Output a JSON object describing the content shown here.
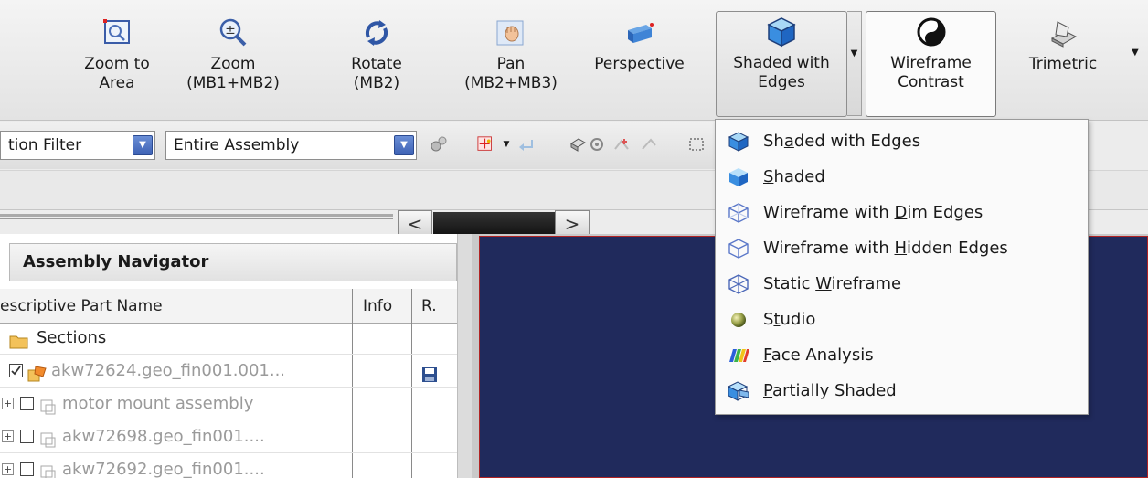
{
  "ribbon": {
    "buttons": [
      {
        "id": "zoom-area",
        "label": "Zoom to\nArea"
      },
      {
        "id": "zoom",
        "label": "Zoom\n(MB1+MB2)"
      },
      {
        "id": "rotate",
        "label": "Rotate\n(MB2)"
      },
      {
        "id": "pan",
        "label": "Pan\n(MB2+MB3)"
      },
      {
        "id": "perspective",
        "label": "Perspective"
      },
      {
        "id": "shaded-edges",
        "label": "Shaded with\nEdges"
      },
      {
        "id": "wireframe-contrast",
        "label": "Wireframe\nContrast"
      },
      {
        "id": "trimetric",
        "label": "Trimetric"
      }
    ]
  },
  "toolbar": {
    "selection_filter": "tion Filter",
    "scope": "Entire Assembly"
  },
  "navigator": {
    "title": "Assembly Navigator",
    "columns": {
      "name": "escriptive Part Name",
      "info": "Info",
      "r": "R."
    },
    "rows": [
      {
        "name": "Sections"
      },
      {
        "name": "akw72624.geo_fin001.001..."
      },
      {
        "name": "motor mount assembly"
      },
      {
        "name": "akw72698.geo_fin001...."
      },
      {
        "name": "akw72692.geo_fin001...."
      }
    ]
  },
  "menu": {
    "items": [
      {
        "pre": "Sh",
        "u": "a",
        "post": "ded with Edges"
      },
      {
        "pre": "",
        "u": "S",
        "post": "haded"
      },
      {
        "pre": "Wireframe with ",
        "u": "D",
        "post": "im Edges"
      },
      {
        "pre": "Wireframe with ",
        "u": "H",
        "post": "idden Edges"
      },
      {
        "pre": "Static ",
        "u": "W",
        "post": "ireframe"
      },
      {
        "pre": "S",
        "u": "t",
        "post": "udio"
      },
      {
        "pre": "",
        "u": "F",
        "post": "ace Analysis"
      },
      {
        "pre": "",
        "u": "P",
        "post": "artially Shaded"
      }
    ]
  },
  "colors": {
    "viewport_bg": "#202a5c",
    "viewport_border": "#b12323",
    "menu_bg": "#fafafa"
  }
}
